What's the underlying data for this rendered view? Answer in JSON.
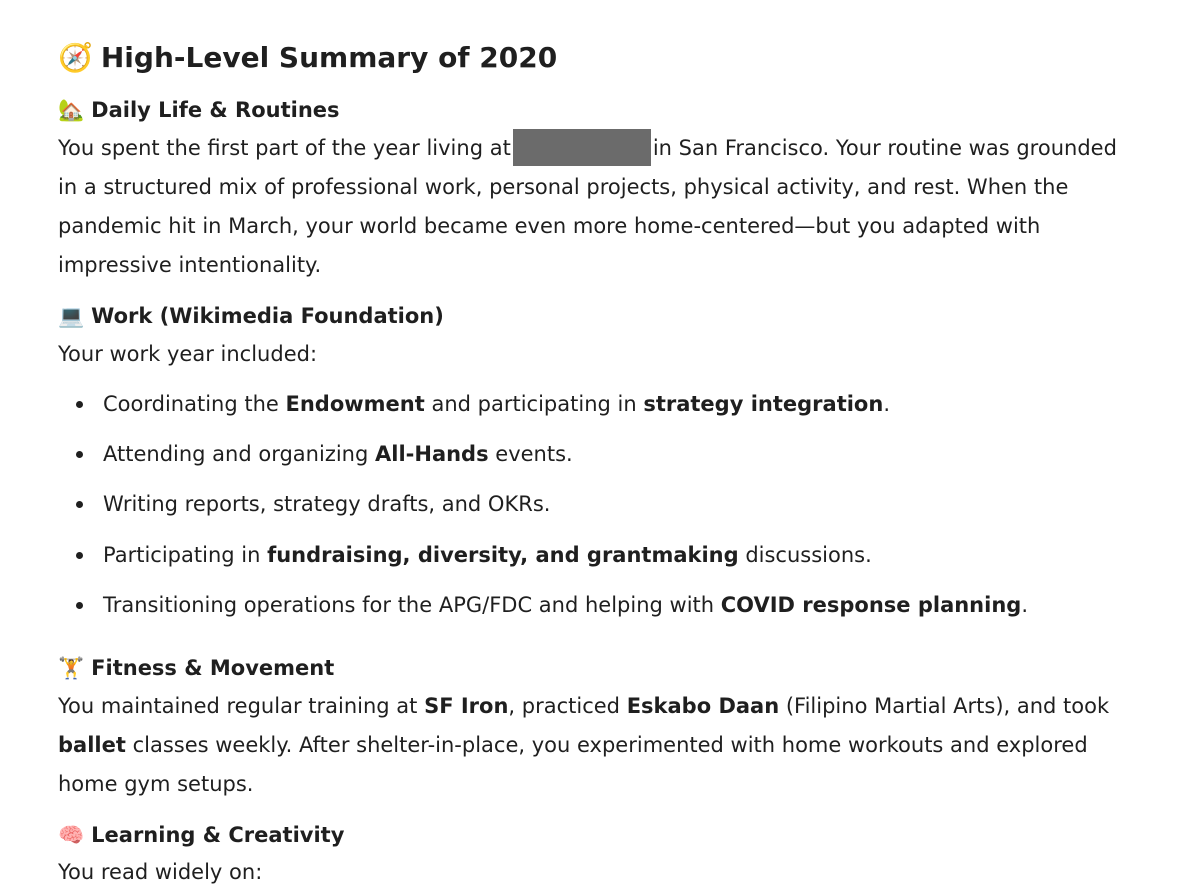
{
  "title": {
    "emoji": "🧭",
    "text": "High-Level Summary of 2020"
  },
  "daily": {
    "emoji": "🏡",
    "heading": "Daily Life & Routines",
    "p_before": "You spent the first part of the year living at",
    "p_after": "in San Francisco. Your routine was grounded in a structured mix of professional work, personal projects, physical activity, and rest. When the pandemic hit in March, your world became even more home-centered—but you adapted with impressive intentionality."
  },
  "work": {
    "emoji": "💻",
    "heading": "Work (Wikimedia Foundation)",
    "intro": "Your work year included:",
    "bullets": [
      {
        "a": "Coordinating the ",
        "b": "Endowment",
        "c": " and participating in ",
        "d": "strategy integration",
        "e": "."
      },
      {
        "a": "Attending and organizing ",
        "b": "All-Hands",
        "c": " events.",
        "d": "",
        "e": ""
      },
      {
        "a": "Writing reports, strategy drafts, and OKRs.",
        "b": "",
        "c": "",
        "d": "",
        "e": ""
      },
      {
        "a": "Participating in ",
        "b": "fundraising, diversity, and grantmaking",
        "c": " discussions.",
        "d": "",
        "e": ""
      },
      {
        "a": "Transitioning operations for the APG/FDC and helping with ",
        "b": "COVID response planning",
        "c": ".",
        "d": "",
        "e": ""
      }
    ]
  },
  "fitness": {
    "emoji": "🏋️",
    "heading": "Fitness & Movement",
    "p1": "You maintained regular training at ",
    "b1": "SF Iron",
    "p2": ", practiced ",
    "b2": "Eskabo Daan",
    "p3": " (Filipino Martial Arts), and took ",
    "b3": "ballet",
    "p4": " classes weekly. After shelter-in-place, you experimented with home workouts and explored home gym setups."
  },
  "learning": {
    "emoji": "🧠",
    "heading": "Learning & Creativity",
    "intro": "You read widely on:"
  }
}
